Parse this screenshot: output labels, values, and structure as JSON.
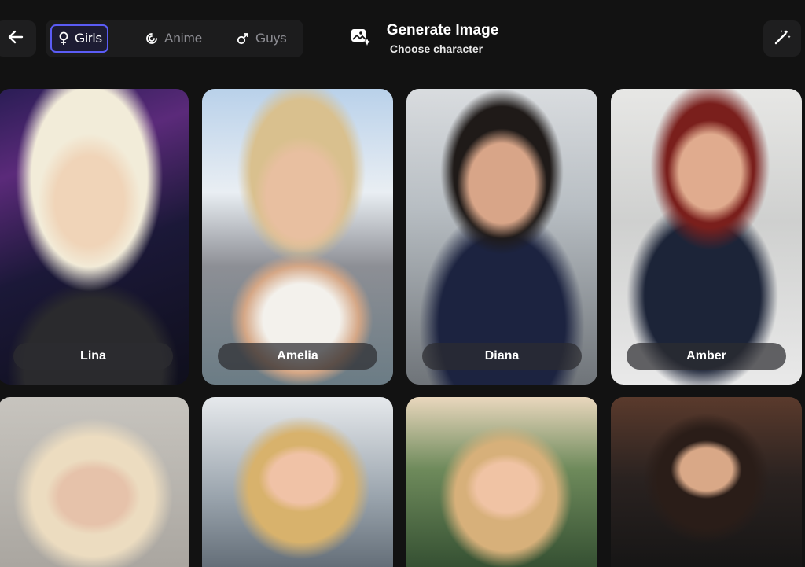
{
  "header": {
    "back_icon": "arrow-left-icon",
    "filters": [
      {
        "label": "Girls",
        "icon": "female-icon",
        "active": true
      },
      {
        "label": "Anime",
        "icon": "anime-icon",
        "active": false
      },
      {
        "label": "Guys",
        "icon": "male-icon",
        "active": false
      }
    ],
    "title": "Generate Image",
    "subtitle": "Choose character",
    "title_icon": "image-sparkle-icon",
    "magic_icon": "magic-wand-icon",
    "accent_color": "#5b5cf6"
  },
  "characters": [
    {
      "name": "Lina"
    },
    {
      "name": "Amelia"
    },
    {
      "name": "Diana"
    },
    {
      "name": "Amber"
    },
    {
      "name": ""
    },
    {
      "name": ""
    },
    {
      "name": ""
    },
    {
      "name": ""
    }
  ]
}
